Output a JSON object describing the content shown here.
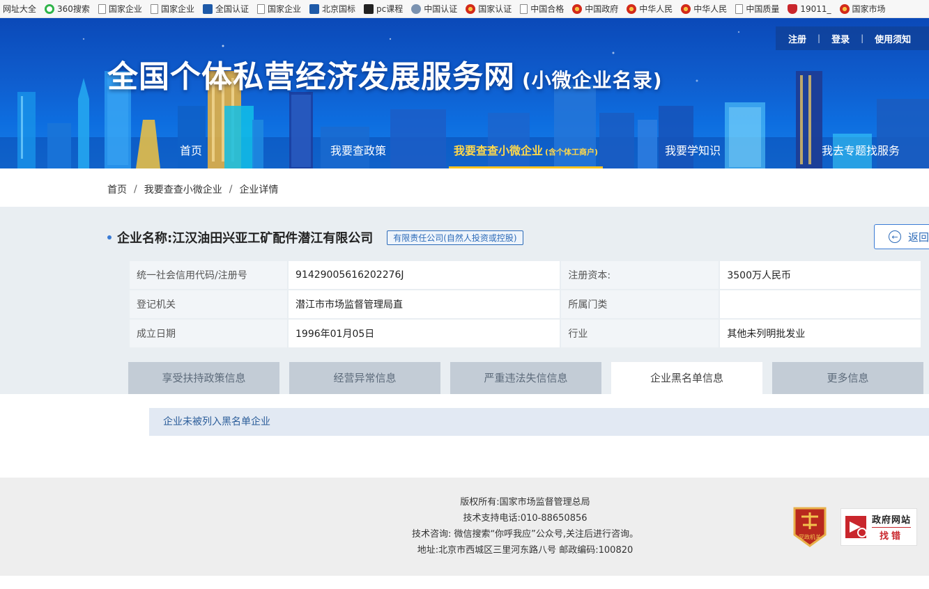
{
  "bookmarks": [
    {
      "label": "网址大全",
      "icon": "none-icon"
    },
    {
      "label": "360搜索",
      "icon": "circle-360-icon"
    },
    {
      "label": "国家企业",
      "icon": "page-icon"
    },
    {
      "label": "国家企业",
      "icon": "page-icon"
    },
    {
      "label": "全国认证",
      "icon": "blue-block-icon"
    },
    {
      "label": "国家企业",
      "icon": "page-icon"
    },
    {
      "label": "北京国标",
      "icon": "blue-block-icon"
    },
    {
      "label": "pc课程",
      "icon": "dark-block-icon"
    },
    {
      "label": "中国认证",
      "icon": "seal-icon"
    },
    {
      "label": "国家认证",
      "icon": "emblem-icon"
    },
    {
      "label": "中国合格",
      "icon": "page-icon"
    },
    {
      "label": "中国政府",
      "icon": "emblem-icon"
    },
    {
      "label": "中华人民",
      "icon": "emblem-icon"
    },
    {
      "label": "中华人民",
      "icon": "emblem-icon"
    },
    {
      "label": "中国质量",
      "icon": "page-icon"
    },
    {
      "label": "19011_",
      "icon": "red-mark-icon"
    },
    {
      "label": "国家市场",
      "icon": "emblem-icon"
    }
  ],
  "header": {
    "top_links": {
      "register": "注册",
      "login": "登录",
      "guide": "使用须知"
    },
    "title": "全国个体私营经济发展服务网",
    "title_sub": "(小微企业名录)",
    "nav": [
      {
        "label": "首页",
        "sub": ""
      },
      {
        "label": "我要查政策",
        "sub": ""
      },
      {
        "label": "我要查查小微企业",
        "sub": "(含个体工商户)"
      },
      {
        "label": "我要学知识",
        "sub": ""
      },
      {
        "label": "我去专题找服务",
        "sub": ""
      }
    ],
    "active_nav_index": 2
  },
  "breadcrumb": {
    "home": "首页",
    "level2": "我要查查小微企业",
    "current": "企业详情"
  },
  "company": {
    "name_label": "企业名称:",
    "name": "江汉油田兴亚工矿配件潜江有限公司",
    "type": "有限责任公司(自然人投资或控股)",
    "back_label": "返回"
  },
  "info_rows": [
    {
      "label1": "统一社会信用代码/注册号",
      "value1": "91429005616202276J",
      "label2": "注册资本:",
      "value2": "3500万人民币"
    },
    {
      "label1": "登记机关",
      "value1": "潜江市市场监督管理局直",
      "label2": "所属门类",
      "value2": ""
    },
    {
      "label1": "成立日期",
      "value1": "1996年01月05日",
      "label2": "行业",
      "value2": "其他未列明批发业"
    }
  ],
  "tabs": [
    "享受扶持政策信息",
    "经营异常信息",
    "严重违法失信信息",
    "企业黑名单信息",
    "更多信息"
  ],
  "active_tab_index": 3,
  "notice": "企业未被列入黑名单企业",
  "footer": {
    "copyright": "版权所有:国家市场监督管理总局",
    "phone": "技术支持电话:010-88650856",
    "consult": "技术咨询: 微信搜索“你呼我应”公众号,关注后进行咨询。",
    "address": "地址:北京市西城区三里河东路八号 邮政编码:100820",
    "party_badge_text": "党政机关",
    "gov_badge_line1": "政府网站",
    "gov_badge_line2": "找错"
  },
  "colors": {
    "banner": "#0f5fd0",
    "nav_active": "#ffd84a",
    "accent": "#2b6ab8",
    "zone_bg": "#e9eef2"
  }
}
